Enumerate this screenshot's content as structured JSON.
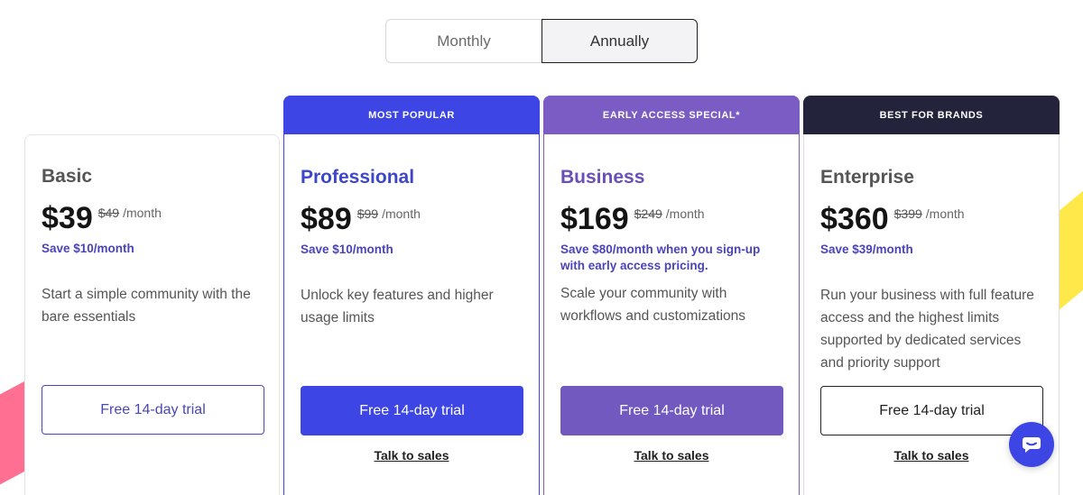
{
  "billing_toggle": {
    "monthly": "Monthly",
    "annually": "Annually",
    "selected": "Annually"
  },
  "plans": [
    {
      "name": "Basic",
      "ribbon": "",
      "price": "$39",
      "old_price": "$49",
      "per": "/month",
      "save": "Save $10/month",
      "description": "Start a simple community with the bare essentials",
      "cta": "Free 14-day trial",
      "sales": ""
    },
    {
      "name": "Professional",
      "ribbon": "MOST POPULAR",
      "price": "$89",
      "old_price": "$99",
      "per": "/month",
      "save": "Save $10/month",
      "description": "Unlock key features and higher usage limits",
      "cta": "Free 14-day trial",
      "sales": "Talk to sales"
    },
    {
      "name": "Business",
      "ribbon": "EARLY ACCESS SPECIAL*",
      "price": "$169",
      "old_price": "$249",
      "per": "/month",
      "save": "Save $80/month when you sign-up with early access pricing.",
      "description": "Scale your community with workflows and customizations",
      "cta": "Free 14-day trial",
      "sales": "Talk to sales"
    },
    {
      "name": "Enterprise",
      "ribbon": "BEST FOR BRANDS",
      "price": "$360",
      "old_price": "$399",
      "per": "/month",
      "save": "Save $39/month",
      "description": "Run your business with full feature access and the highest limits supported by dedicated services and priority support",
      "cta": "Free 14-day trial",
      "sales": "Talk to sales"
    }
  ],
  "chat": {
    "icon": "chat-bubble-icon"
  },
  "colors": {
    "primary": "#3d45e5",
    "business": "#7b5cc4",
    "enterprise_ribbon": "#23233b"
  }
}
